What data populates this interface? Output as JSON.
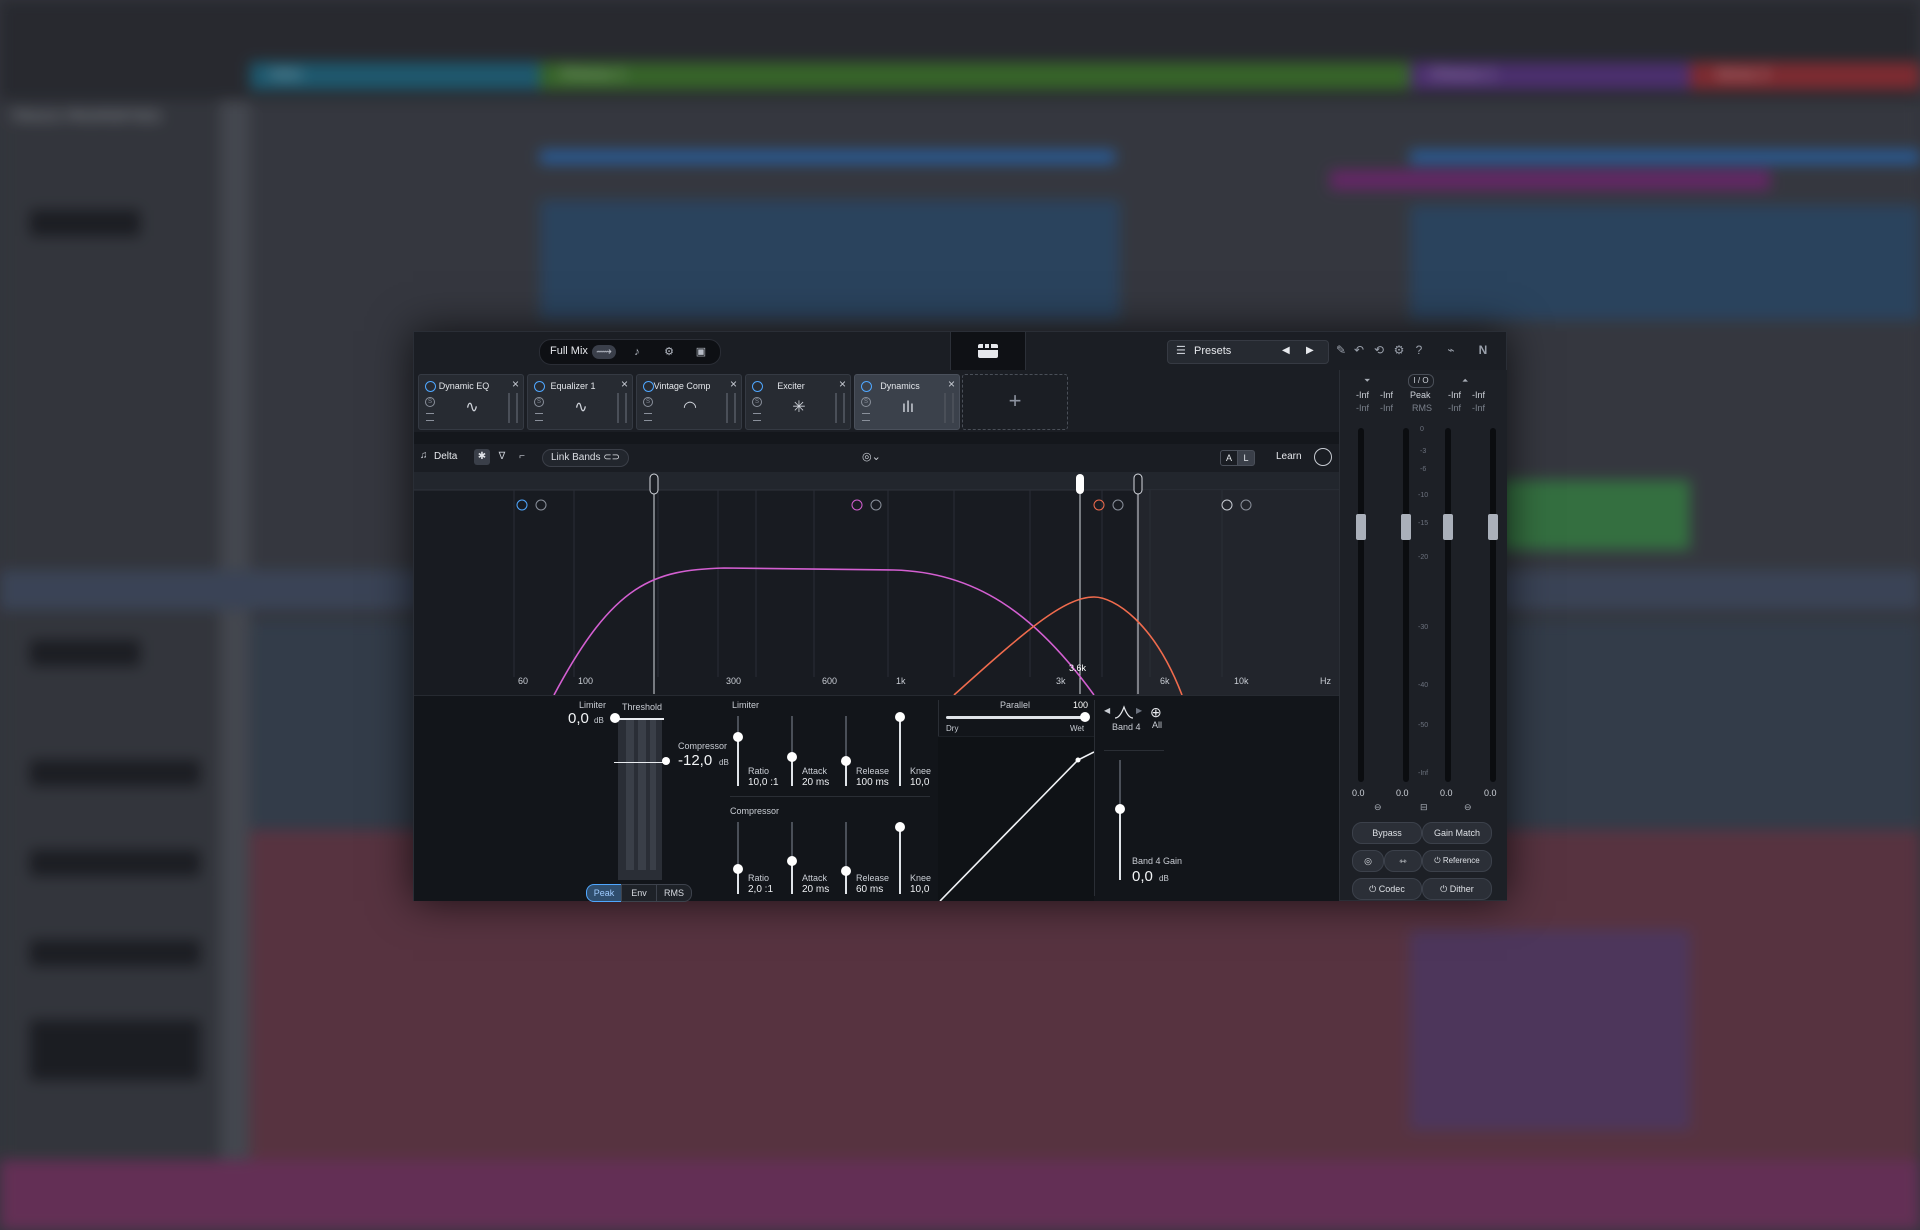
{
  "plugin": {
    "mode_label": "Full Mix",
    "presets_label": "Presets",
    "modules": [
      {
        "name": "Dynamic EQ",
        "icon": "dynamic-eq-icon"
      },
      {
        "name": "Equalizer 1",
        "icon": "equalizer-icon"
      },
      {
        "name": "Vintage Comp",
        "icon": "vintage-comp-icon"
      },
      {
        "name": "Exciter",
        "icon": "exciter-icon"
      },
      {
        "name": "Dynamics",
        "icon": "dynamics-icon"
      }
    ],
    "add_module": "+",
    "toolbar": {
      "delta_label": "Delta",
      "link_bands_label": "Link Bands",
      "a_label": "A",
      "b_label": "L",
      "learn_label": "Learn"
    },
    "freq_labels": [
      "60",
      "100",
      "300",
      "600",
      "1k",
      "3k",
      "3.6k",
      "6k",
      "10k",
      "Hz"
    ],
    "lower": {
      "limiter_label": "Limiter",
      "threshold_label": "Threshold",
      "limiter_value": "0,0",
      "db_unit": "dB",
      "compressor_label": "Compressor",
      "compressor_value": "-12,0",
      "detection": [
        "Peak",
        "Env",
        "RMS"
      ],
      "limiter_section": "Limiter",
      "compressor_section": "Compressor",
      "limiter_params": [
        {
          "label": "Ratio",
          "value": "10,0 :1"
        },
        {
          "label": "Attack",
          "value": "20 ms"
        },
        {
          "label": "Release",
          "value": "100 ms"
        },
        {
          "label": "Knee",
          "value": "10,0"
        }
      ],
      "compressor_params": [
        {
          "label": "Ratio",
          "value": "2,0 :1"
        },
        {
          "label": "Attack",
          "value": "20 ms"
        },
        {
          "label": "Release",
          "value": "60 ms"
        },
        {
          "label": "Knee",
          "value": "10,0"
        }
      ],
      "parallel_label": "Parallel",
      "parallel_value": "100",
      "dry_label": "Dry",
      "wet_label": "Wet",
      "band_label": "Band 4",
      "all_label": "All",
      "band_gain_label": "Band 4 Gain",
      "band_gain_value": "0,0"
    },
    "meters": {
      "io_label": "I / O",
      "peak_label": "Peak",
      "rms_label": "RMS",
      "inf": "-Inf",
      "scale": [
        "0",
        "-3",
        "-6",
        "-10",
        "-15",
        "-20",
        "-30",
        "-40",
        "-50",
        "-Inf"
      ],
      "readouts": [
        "0.0",
        "0.0",
        "0.0",
        "0.0"
      ],
      "bypass_label": "Bypass",
      "gain_match_label": "Gain Match",
      "reference_label": "Reference",
      "codec_label": "Codec",
      "dither_label": "Dither"
    }
  },
  "daw": {
    "section_labels": [
      "Intro",
      "Chorus 1",
      "Chorus 1",
      "Verse 2"
    ],
    "track_header": "TRACK PROPERTIES"
  },
  "colors": {
    "accent_blue": "#4fa7ff",
    "band_pink": "#d35fd1",
    "band_orange": "#ef6b4d"
  }
}
